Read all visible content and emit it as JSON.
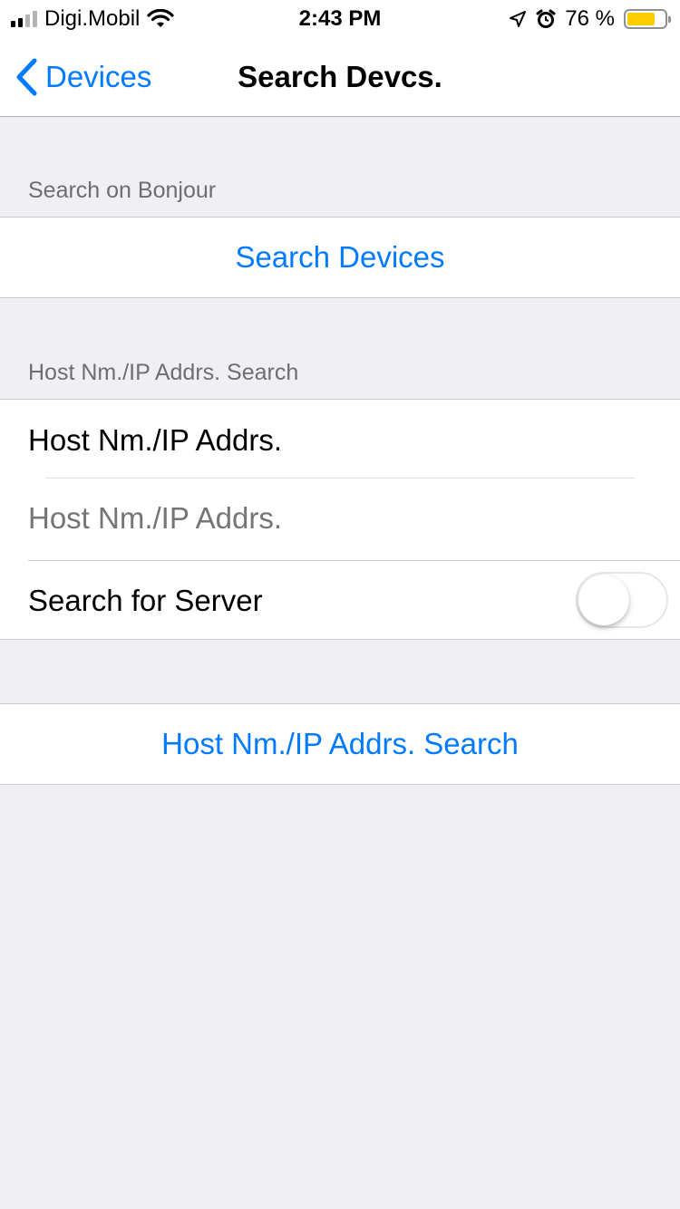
{
  "status_bar": {
    "carrier": "Digi.Mobil",
    "time": "2:43 PM",
    "battery_text": "76 %",
    "battery_level": 0.76,
    "battery_color": "#ffcc00",
    "icons": [
      "signal-icon",
      "wifi-icon",
      "location-arrow-icon",
      "alarm-icon",
      "battery-icon"
    ]
  },
  "nav": {
    "back_label": "Devices",
    "title": "Search Devcs."
  },
  "sections": {
    "bonjour_header": "Search on Bonjour",
    "search_devices_button": "Search Devices",
    "host_header": "Host Nm./IP Addrs. Search",
    "host_label": "Host Nm./IP Addrs.",
    "host_input_placeholder": "Host Nm./IP Addrs.",
    "host_input_value": "",
    "server_toggle_label": "Search for Server",
    "server_toggle_on": false,
    "host_search_button": "Host Nm./IP Addrs. Search"
  },
  "colors": {
    "accent": "#007aff",
    "background": "#efeff4"
  }
}
